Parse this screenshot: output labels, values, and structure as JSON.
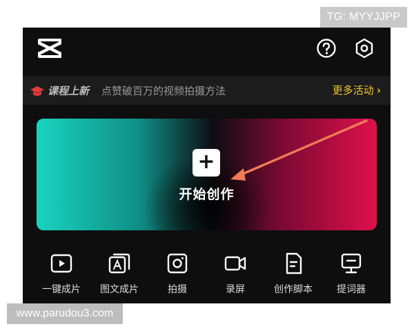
{
  "watermarks": {
    "tg": "TG: MYYJJPP",
    "site": "www.parudou3.com"
  },
  "topbar": {
    "logo_icon": "capcut-logo-icon",
    "help_icon": "help-icon",
    "settings_icon": "settings-hexagon-icon"
  },
  "banner": {
    "tag": "课程上新",
    "text": "点赞破百万的视频拍摄方法",
    "more": "更多活动",
    "more_chevron": "›",
    "tag_icon": "graduation-cap-icon",
    "tag_icon_color": "#e23a3a",
    "more_color": "#f5c527"
  },
  "create_card": {
    "label": "开始创作",
    "plus": "+",
    "gradient_left": "#19d3c0",
    "gradient_right": "#e0104c",
    "annotation_arrow_color": "#f07a55"
  },
  "tools": [
    {
      "label": "一键成片",
      "icon": "play-square-icon"
    },
    {
      "label": "图文成片",
      "icon": "image-text-icon"
    },
    {
      "label": "拍摄",
      "icon": "camera-icon"
    },
    {
      "label": "录屏",
      "icon": "video-record-icon"
    },
    {
      "label": "创作脚本",
      "icon": "script-document-icon"
    },
    {
      "label": "提词器",
      "icon": "teleprompter-icon"
    }
  ]
}
